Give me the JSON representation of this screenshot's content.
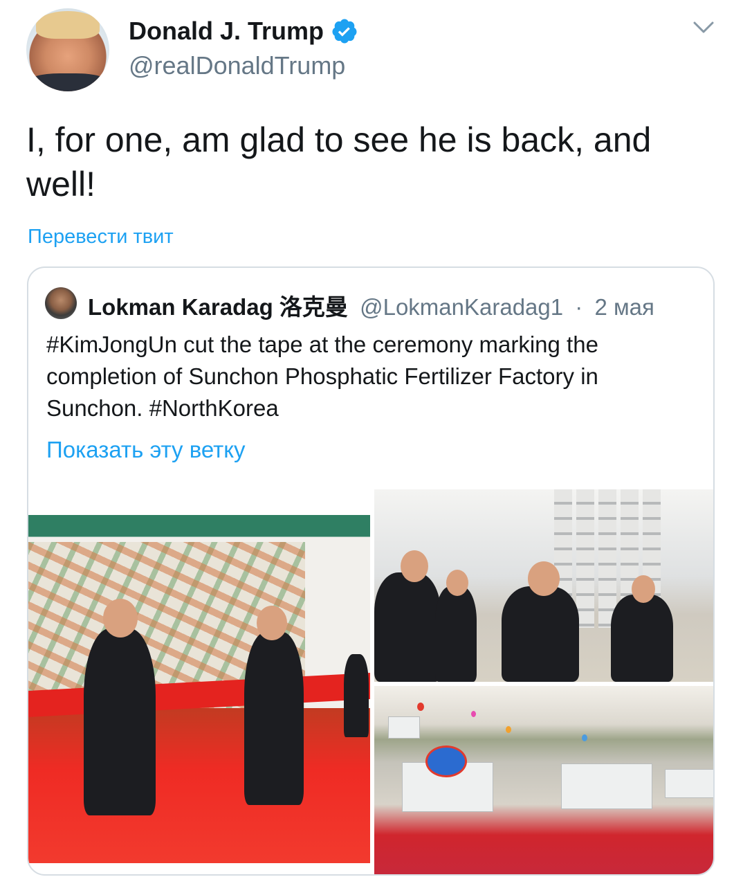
{
  "tweet": {
    "author": {
      "display_name": "Donald J. Trump",
      "handle": "@realDonaldTrump",
      "verified": true,
      "avatar_icon": "user-avatar"
    },
    "menu_icon": "chevron-down-icon",
    "text": "I, for one, am glad to see he is back, and well!",
    "translate_label": "Перевести твит"
  },
  "quoted_tweet": {
    "author": {
      "display_name": "Lokman Karadag 洛克曼",
      "handle": "@LokmanKaradag1",
      "separator": "·",
      "date": "2 мая"
    },
    "text": "#KimJongUn cut the tape at the ceremony marking the completion of Sunchon Phosphatic Fertilizer Factory in Sunchon. #NorthKorea",
    "show_thread_label": "Показать эту ветку",
    "media_count": 3
  },
  "colors": {
    "link": "#1da1f2",
    "secondary_text": "#657786",
    "border": "#d6dde3",
    "verified": "#1da1f2"
  }
}
